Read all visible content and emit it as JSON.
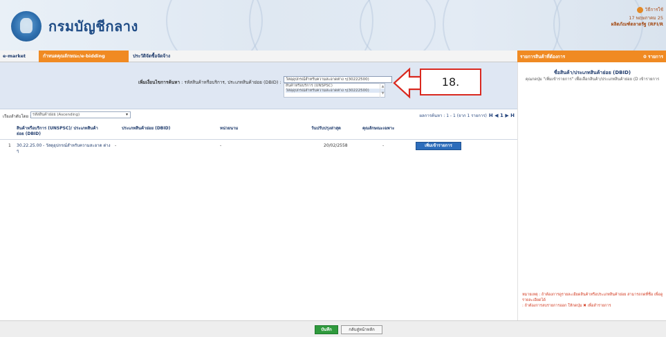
{
  "header": {
    "brand": "กรมบัญชีกลาง",
    "help_label": "วิธีการใช้",
    "date": "17 พฤษภาคม 25",
    "user": "ผลิตภัณฑ์ตลาดรัฐ (RFI/R"
  },
  "menu": {
    "tabs": [
      {
        "label": "e-market"
      },
      {
        "label": "กำหนดคุณลักษณะ/e-bidding"
      },
      {
        "label": "ประวัติจัดซื้อจัดจ้าง"
      }
    ],
    "right_title": "รายการสินค้าที่ต้องการ",
    "right_count": "0 รายการ"
  },
  "filter": {
    "label_bold": "เพิ่มเงื่อนไขการค้นหา",
    "label_rest": ": รหัสสินค้าหรือบริการ, ประเภทสินค้าย่อย (DBID) :",
    "selected_value": "วัสดุอุปกรณ์สำหรับความสะอาดต่าง ๆ(30222500)",
    "options": [
      "สินค้าหรือบริการ (UNSPSC)",
      "วัสดุอุปกรณ์สำหรับความสะอาดต่าง ๆ(30222500)"
    ]
  },
  "callout": {
    "label": "18."
  },
  "toolbar": {
    "sort_label": "เรียงลำดับโดย :",
    "sort_value": "รหัสสินค้าย่อย (Ascending)",
    "pager_text": "ผลการค้นหา : 1 - 1 (จาก 1 รายการ)",
    "pager_nav": "H ◀ 1 ▶ H"
  },
  "table": {
    "headers": [
      {
        "text": "สินค้าหรือบริการ (UNSPSC)/ ประเภทสินค้าย่อย (DBID)"
      },
      {
        "text": "ประเภทสินค้าย่อย (DBID)"
      },
      {
        "text": "หน่วยนาม"
      },
      {
        "text": "วันปรับปรุงล่าสุด"
      },
      {
        "text": "คุณลักษณะเฉพาะ"
      }
    ],
    "rows": [
      {
        "index": "1",
        "item": "30.22.25.00 - วัสดุอุปกรณ์สำหรับความสะอาด ต่าง ๆ",
        "dbid": "-",
        "unit": "-",
        "updated": "20/02/2558",
        "spec": "-",
        "action": "เพิ่มเข้ารายการ"
      }
    ]
  },
  "right_panel": {
    "title": "ชื่อสินค้า/ประเภทสินค้าย่อย (DBID)",
    "instruction": "คุณกดปุ่ม \"เพิ่มเข้ารายการ\" เพื่อเลือกสินค้า/ประเภทสินค้าย่อย (D เข้ารายการ",
    "note_1": "หมายเหตุ : ถ้าต้องการดูรายละเอียดสินค้าหรือประเภทสินค้าย่อย สามารถกดที่ชื่อ เพื่อดูรายละเอียดได้",
    "note_2": ": ถ้าต้องการลบรายการออก ให้กดปุ่ม",
    "note_3": "เพื่อลำรายการ"
  },
  "buttons": {
    "save": "บันทึก",
    "back": "กลับสู่หน้าหลัก"
  },
  "colors": {
    "accent_orange": "#f08a22",
    "button_blue": "#2d6dbb",
    "save_green": "#2f9a3d",
    "callout_red": "#d9281f"
  }
}
